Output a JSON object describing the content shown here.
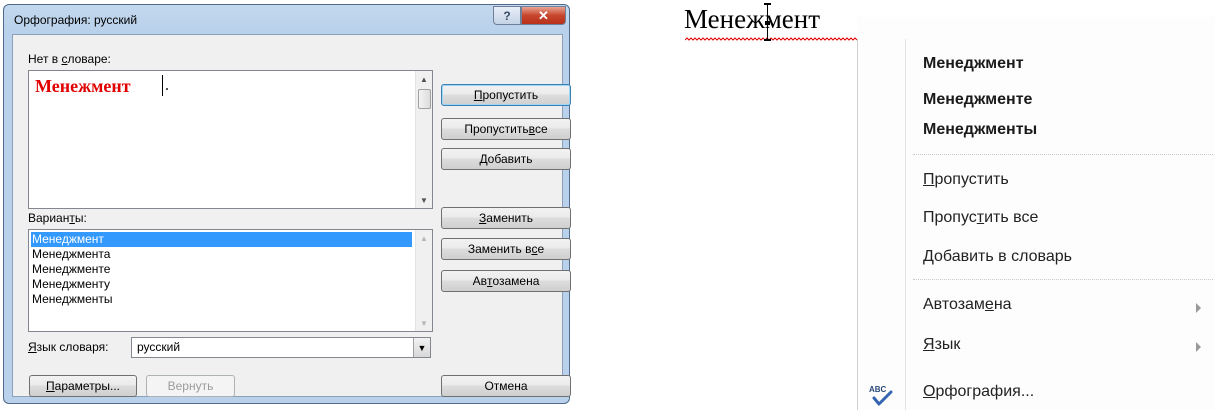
{
  "dialog": {
    "title": "Орфография: русский",
    "help_glyph": "?",
    "close_glyph": "✕",
    "not_in_dict_label_pre": "Нет в ",
    "not_in_dict_label_u": "с",
    "not_in_dict_label_post": "ловаре:",
    "misspelled_word": "Менежмент",
    "suggestions_label_pre": "Вариан",
    "suggestions_label_u": "т",
    "suggestions_label_post": "ы:",
    "suggestions": [
      "Менеджмент",
      "Менеджмента",
      "Менеджменте",
      "Менеджменту",
      "Менеджменты"
    ],
    "selected_suggestion_index": 0,
    "buttons": {
      "skip_u": "П",
      "skip_rest": "ропустить",
      "skip_all_pre": "Пропустить ",
      "skip_all_u": "в",
      "skip_all_post": "се",
      "add_u": "Д",
      "add_rest": "обавить",
      "replace_u": "З",
      "replace_rest": "аменить",
      "replace_all_pre": "Заменить в",
      "replace_all_u": "с",
      "replace_all_post": "е",
      "autocorrect_pre": "Ав",
      "autocorrect_u": "т",
      "autocorrect_post": "озамена",
      "options_u": "П",
      "options_rest": "араметры...",
      "undo": "Вернуть",
      "cancel": "Отмена"
    },
    "dict_lang_label_u": "Я",
    "dict_lang_label_rest": "зык словаря:",
    "dict_lang_value": "русский"
  },
  "context_menu": {
    "target_word": "Менежмент",
    "suggestions": [
      "Менеджмент",
      "Менеджменте",
      "Менеджменты"
    ],
    "skip_u": "П",
    "skip_rest": "ропустить",
    "skip_all_pre": "Пропус",
    "skip_all_u": "т",
    "skip_all_post": "ить все",
    "add_u": "Д",
    "add_rest": "обавить в словарь",
    "autocorrect_pre": "Автозам",
    "autocorrect_u": "е",
    "autocorrect_post": "на",
    "language_u": "Я",
    "language_rest": "зык",
    "spelling_u": "О",
    "spelling_rest": "рфография..."
  },
  "colors": {
    "misspelled": "#e00000",
    "selection": "#3399ff",
    "squiggle": "#e00000"
  }
}
